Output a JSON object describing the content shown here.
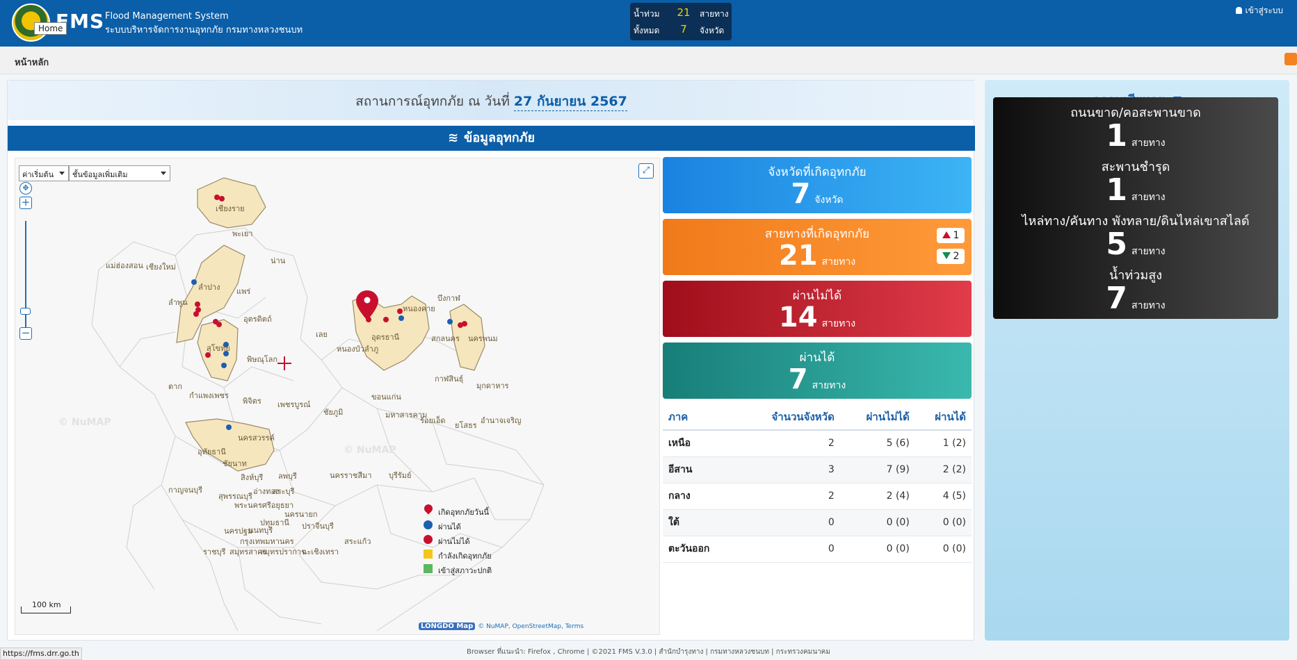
{
  "header": {
    "brand": "FMS",
    "subtitle_en": "Flood Management System",
    "subtitle_th": "ระบบบริหารจัดการงานอุทกภัย กรมทางหลวงชนบท",
    "home_tooltip": "Home",
    "login_label": "เข้าสู่ระบบ",
    "summary": {
      "row1_label": "น้ำท่วม",
      "row1_value": "21",
      "row1_unit": "สายทาง",
      "row2_label": "ทั้งหมด",
      "row2_value": "7",
      "row2_unit": "จังหวัด"
    }
  },
  "subbar": {
    "breadcrumb": "หน้าหลัก"
  },
  "banner": {
    "prefix": "สถานการณ์อุทกภัย ณ วันที่",
    "date": "27 กันยายน 2567"
  },
  "section": {
    "title": "ข้อมูลอุทกภัย"
  },
  "map": {
    "select1": "ค่าเริ่มต้น",
    "select2": "ชั้นข้อมูลเพิ่มเติม",
    "scale_label": "100 km",
    "watermarks": [
      "© NuMAP",
      "© NuMAP"
    ],
    "attribution": "© NuMAP, OpenStreetMap, Terms",
    "attribution_logo": "LONGDO Map",
    "legend": [
      {
        "label": "เกิดอุทกภัยวันนี้",
        "kind": "pin",
        "color": "#c8102e"
      },
      {
        "label": "ผ่านได้",
        "kind": "dot",
        "color": "#1b5fb0"
      },
      {
        "label": "ผ่านไม่ได้",
        "kind": "dot",
        "color": "#c8102e"
      },
      {
        "label": "กำลังเกิดอุทกภัย",
        "kind": "square",
        "color": "#f5c518"
      },
      {
        "label": "เข้าสู่สภาวะปกติ",
        "kind": "square",
        "color": "#5cb85c"
      }
    ],
    "place_names": [
      "เชียงราย",
      "พะเยา",
      "น่าน",
      "แม่ฮ่องสอน",
      "เชียงใหม่",
      "ลำปาง",
      "แพร่",
      "ลำพูน",
      "อุตรดิตถ์",
      "สุโขทัย",
      "พิษณุโลก",
      "เลย",
      "หนองบัวลำภู",
      "อุดรธานี",
      "หนองคาย",
      "บึงกาฬ",
      "สกลนคร",
      "นครพนม",
      "กาฬสินธุ์",
      "มุกดาหาร",
      "ตาก",
      "กำแพงเพชร",
      "พิจิตร",
      "เพชรบูรณ์",
      "ชัยภูมิ",
      "ขอนแก่น",
      "มหาสารคาม",
      "ร้อยเอ็ด",
      "ยโสธร",
      "อำนาจเจริญ",
      "นครสวรรค์",
      "อุทัยธานี",
      "ชัยนาท",
      "ลพบุรี",
      "สิงห์บุรี",
      "นครราชสีมา",
      "บุรีรัมย์",
      "กาญจนบุรี",
      "สุพรรณบุรี",
      "อ่างทอง",
      "สระบุรี",
      "พระนครศรีอยุธยา",
      "ปทุมธานี",
      "นครนายก",
      "ปราจีนบุรี",
      "นนทบุรี",
      "นครปฐม",
      "กรุงเทพมหานคร",
      "ราชบุรี",
      "สมุทรสาคร",
      "สมุทรปราการ",
      "ฉะเชิงเทรา",
      "สระแก้ว"
    ]
  },
  "stats": [
    {
      "title": "จังหวัดที่เกิดอุทกภัย",
      "value": "7",
      "unit": "จังหวัด"
    },
    {
      "title": "สายทางที่เกิดอุทกภัย",
      "value": "21",
      "unit": "สายทาง",
      "up": "1",
      "down": "2"
    },
    {
      "title": "ผ่านไม่ได้",
      "value": "14",
      "unit": "สายทาง"
    },
    {
      "title": "ผ่านได้",
      "value": "7",
      "unit": "สายทาง"
    }
  ],
  "region_table": {
    "headers": [
      "ภาค",
      "จำนวนจังหวัด",
      "ผ่านไม่ได้",
      "ผ่านได้"
    ],
    "rows": [
      [
        "เหนือ",
        "2",
        "5 (6)",
        "1 (2)"
      ],
      [
        "อีสาน",
        "3",
        "7 (9)",
        "2 (2)"
      ],
      [
        "กลาง",
        "2",
        "2 (4)",
        "4 (5)"
      ],
      [
        "ใต้",
        "0",
        "0 (0)",
        "0 (0)"
      ],
      [
        "ตะวันออก",
        "0",
        "0 (0)",
        "0 (0)"
      ]
    ]
  },
  "damage": {
    "title": "ความเสียหาย",
    "items": [
      {
        "title": "ถนนขาด/คอสะพานขาด",
        "value": "1",
        "unit": "สายทาง"
      },
      {
        "title": "สะพานชำรุด",
        "value": "1",
        "unit": "สายทาง"
      },
      {
        "title": "ไหล่ทาง/คันทาง พังทลาย/ดินไหล่เขาสไลด์",
        "value": "5",
        "unit": "สายทาง"
      },
      {
        "title": "น้ำท่วมสูง",
        "value": "7",
        "unit": "สายทาง"
      }
    ]
  },
  "footer": {
    "text": "Browser ที่แนะนำ: Firefox , Chrome | ©2021 FMS V.3.0 | สำนักบำรุงทาง | กรมทางหลวงชนบท | กระทรวงคมนาคม",
    "status_url": "https://fms.drr.go.th"
  }
}
